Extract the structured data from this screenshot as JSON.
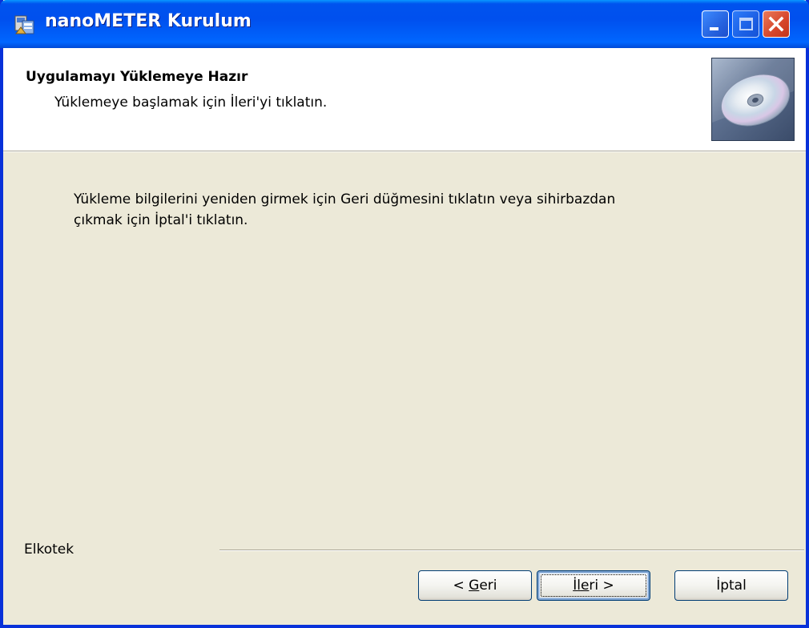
{
  "window": {
    "title": "nanoMETER Kurulum",
    "icon": "installer-icon",
    "controls": [
      "minimize-icon",
      "maximize-icon",
      "close-icon"
    ],
    "title_color": "#0053ee"
  },
  "header": {
    "title": "Uygulamayı Yüklemeye Hazır",
    "subtitle": "Yüklemeye başlamak için İleri'yi tıklatın.",
    "graphic": "cd-icon"
  },
  "body": {
    "line1": "Yükleme bilgilerini yeniden girmek için Geri düğmesini tıklatın veya sihirbazdan",
    "line2": "çıkmak için İptal'i tıklatın."
  },
  "footer": {
    "company": "Elkotek",
    "back": {
      "prefix": "< ",
      "mnemonic": "G",
      "rest": "eri"
    },
    "next": {
      "mnemonic": "İ",
      "middle": "l",
      "mnemonic2": "e",
      "rest": "ri >"
    },
    "cancel": "İptal"
  }
}
